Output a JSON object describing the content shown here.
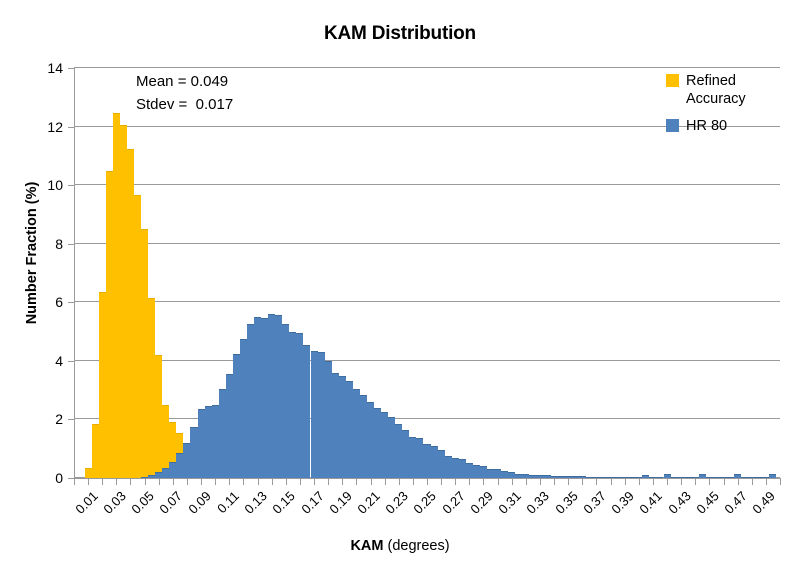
{
  "chart_data": {
    "type": "bar",
    "title": "KAM Distribution",
    "xlabel_bold": "KAM",
    "xlabel_unit": "  (degrees)",
    "ylabel": "Number Fraction  (%)",
    "xlim": [
      0.0025,
      0.5025
    ],
    "ylim": [
      0,
      14
    ],
    "y_ticks": [
      0,
      2,
      4,
      6,
      8,
      10,
      12,
      14
    ],
    "x_ticks": [
      "0.01",
      "0.03",
      "0.05",
      "0.07",
      "0.09",
      "0.11",
      "0.13",
      "0.15",
      "0.17",
      "0.19",
      "0.21",
      "0.23",
      "0.25",
      "0.27",
      "0.29",
      "0.31",
      "0.33",
      "0.35",
      "0.37",
      "0.39",
      "0.41",
      "0.43",
      "0.45",
      "0.47",
      "0.49"
    ],
    "x_tick_values": [
      0.01,
      0.03,
      0.05,
      0.07,
      0.09,
      0.11,
      0.13,
      0.15,
      0.17,
      0.19,
      0.21,
      0.23,
      0.25,
      0.27,
      0.29,
      0.31,
      0.33,
      0.35,
      0.37,
      0.39,
      0.41,
      0.43,
      0.45,
      0.47,
      0.49
    ],
    "grid": "horizontal",
    "legend_position": "top-right",
    "bin_width": 0.005,
    "bin_start": 0.0025,
    "series": [
      {
        "name": "Refined Accuracy",
        "color": "#FFC000",
        "x": [
          0.005,
          0.01,
          0.015,
          0.02,
          0.025,
          0.03,
          0.035,
          0.04,
          0.045,
          0.05,
          0.055,
          0.06,
          0.065,
          0.07,
          0.075,
          0.08,
          0.085,
          0.09,
          0.095,
          0.1,
          0.105,
          0.11,
          0.115
        ],
        "values": [
          0.0,
          0.0,
          0.35,
          1.85,
          6.35,
          10.5,
          12.45,
          12.05,
          11.25,
          9.65,
          8.5,
          6.15,
          4.2,
          2.5,
          1.9,
          1.55,
          0.8,
          0.45,
          0.25,
          0.15,
          0.1,
          0.05,
          0.0
        ]
      },
      {
        "name": "HR 80",
        "color": "#4F81BD",
        "x": [
          0.055,
          0.06,
          0.065,
          0.07,
          0.075,
          0.08,
          0.085,
          0.09,
          0.095,
          0.1,
          0.105,
          0.11,
          0.115,
          0.12,
          0.125,
          0.13,
          0.135,
          0.14,
          0.145,
          0.15,
          0.155,
          0.16,
          0.165,
          0.17,
          0.175,
          0.18,
          0.185,
          0.19,
          0.195,
          0.2,
          0.205,
          0.21,
          0.215,
          0.22,
          0.225,
          0.23,
          0.235,
          0.24,
          0.245,
          0.25,
          0.255,
          0.26,
          0.265,
          0.27,
          0.275,
          0.28,
          0.285,
          0.29,
          0.295,
          0.3,
          0.305,
          0.31,
          0.315,
          0.32,
          0.325,
          0.33,
          0.335,
          0.34,
          0.345,
          0.35,
          0.355,
          0.36,
          0.365,
          0.37,
          0.375,
          0.38,
          0.385,
          0.39,
          0.395,
          0.4,
          0.405,
          0.41,
          0.415,
          0.42,
          0.425,
          0.43,
          0.435,
          0.44,
          0.445,
          0.45,
          0.455,
          0.46,
          0.465,
          0.47,
          0.475,
          0.48,
          0.485,
          0.49,
          0.495,
          0.5
        ],
        "values": [
          0.05,
          0.1,
          0.2,
          0.35,
          0.55,
          0.85,
          1.2,
          1.75,
          2.35,
          2.45,
          2.5,
          3.05,
          3.55,
          4.25,
          4.75,
          5.25,
          5.5,
          5.45,
          5.6,
          5.55,
          5.25,
          5.0,
          4.95,
          4.55,
          4.35,
          4.3,
          4.0,
          3.6,
          3.5,
          3.3,
          3.05,
          2.85,
          2.6,
          2.4,
          2.25,
          2.1,
          1.85,
          1.65,
          1.4,
          1.35,
          1.15,
          1.1,
          0.95,
          0.75,
          0.7,
          0.65,
          0.5,
          0.45,
          0.4,
          0.3,
          0.3,
          0.25,
          0.2,
          0.15,
          0.15,
          0.12,
          0.1,
          0.1,
          0.08,
          0.08,
          0.07,
          0.06,
          0.06,
          0.05,
          0.05,
          0.05,
          0.04,
          0.04,
          0.03,
          0.03,
          0.03,
          0.12,
          0.02,
          0.02,
          0.13,
          0.02,
          0.02,
          0.02,
          0.02,
          0.14,
          0.02,
          0.02,
          0.02,
          0.02,
          0.13,
          0.02,
          0.02,
          0.02,
          0.02,
          0.15
        ]
      }
    ],
    "annotations": [
      {
        "text": "Mean = 0.049"
      },
      {
        "text": "Stdev =  0.017"
      }
    ]
  },
  "legend": {
    "entries": [
      {
        "label": "Refined Accuracy",
        "color": "#FFC000"
      },
      {
        "label": "HR 80",
        "color": "#4F81BD"
      }
    ]
  }
}
